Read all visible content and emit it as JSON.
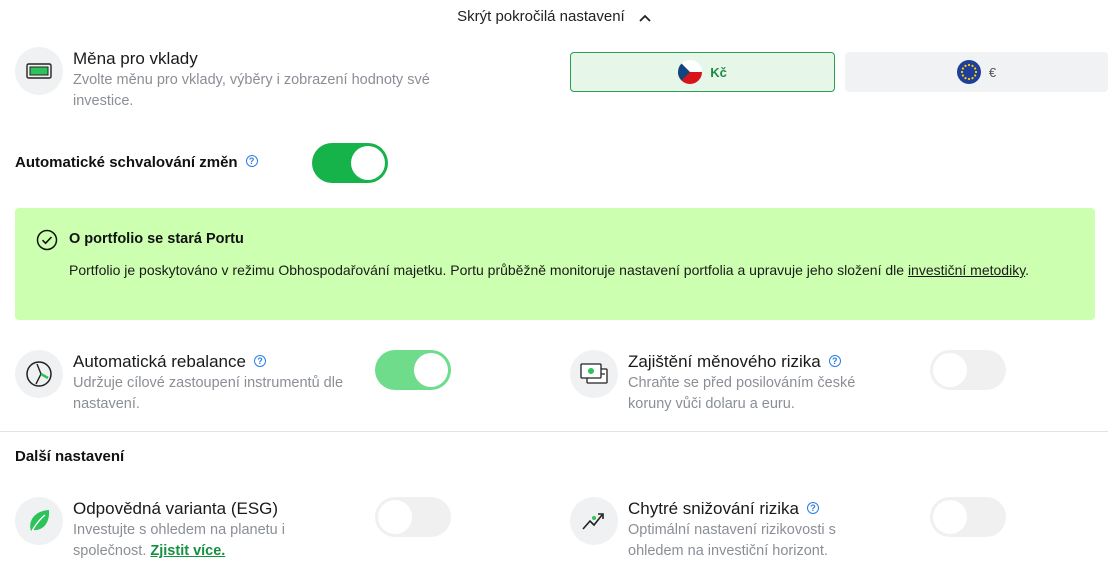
{
  "advanced_toggle": {
    "label": "Skrýt pokročilá nastavení"
  },
  "currency": {
    "title": "Měna pro vklady",
    "description": "Zvolte měnu pro vklady, výběry i zobrazení hodnoty své investice.",
    "options": [
      {
        "label": "Kč",
        "selected": true,
        "flag": "czech-flag-icon"
      },
      {
        "label": "€",
        "selected": false,
        "flag": "eu-flag-icon"
      }
    ]
  },
  "auto_approve": {
    "label": "Automatické schvalování změn",
    "help": "?",
    "enabled": true
  },
  "notice": {
    "title": "O portfolio se stará Portu",
    "text": "Portfolio je poskytováno v režimu Obhospodařování majetku. Portu průběžně monitoruje nastavení portfolia a upravuje jeho složení dle ",
    "link": "investiční metodiky",
    "text_end": "."
  },
  "rebalance": {
    "title": "Automatická rebalance",
    "help": "?",
    "description": "Udržuje cílové zastoupení instrumentů dle nastavení.",
    "enabled": true
  },
  "hedging": {
    "title": "Zajištění měnového rizika",
    "help": "?",
    "description": "Chraňte se před posilováním české koruny vůči dolaru a euru.",
    "enabled": false
  },
  "other_settings": {
    "heading": "Další nastavení"
  },
  "esg": {
    "title": "Odpovědná varianta (ESG)",
    "description": "Investujte s ohledem na planetu i společnost.",
    "link": "Zjistit více.",
    "enabled": false
  },
  "risk_reduction": {
    "title": "Chytré snižování rizika",
    "help": "?",
    "description": "Optimální nastavení rizikovosti s ohledem na investiční horizont.",
    "enabled": false
  },
  "colors": {
    "accent": "#16b34a",
    "notice_bg": "#ccffb0",
    "link": "#15913f",
    "help": "#2b7de9"
  }
}
